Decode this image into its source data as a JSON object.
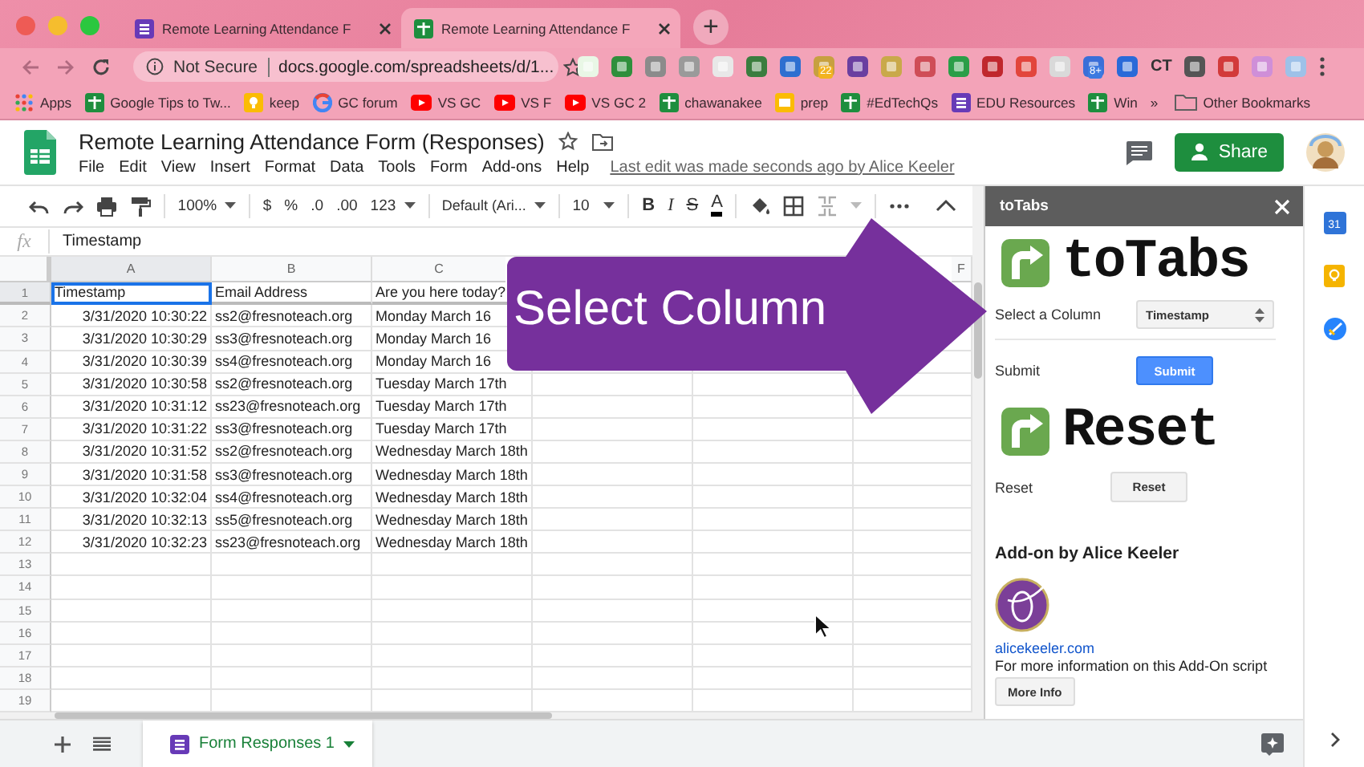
{
  "browser": {
    "tabs": [
      {
        "label": "Remote Learning Attendance F",
        "kind": "forms",
        "selected": false
      },
      {
        "label": "Remote Learning Attendance F",
        "kind": "sheets",
        "selected": true
      }
    ],
    "new_tab": "+",
    "address": {
      "security": "Not Secure",
      "url": "docs.google.com/spreadsheets/d/1..."
    },
    "extension_texts": [
      {
        "kind": "badge",
        "text": "22"
      },
      {
        "kind": "badge",
        "text": "8+"
      },
      {
        "kind": "label",
        "text": "CT"
      }
    ],
    "bookmarks": [
      {
        "label": "Apps",
        "kind": "apps"
      },
      {
        "label": "Google Tips to Tw...",
        "kind": "sheets"
      },
      {
        "label": "keep",
        "kind": "keep"
      },
      {
        "label": "GC forum",
        "kind": "google"
      },
      {
        "label": "VS GC",
        "kind": "youtube"
      },
      {
        "label": "VS F",
        "kind": "youtube"
      },
      {
        "label": "VS GC 2",
        "kind": "youtube"
      },
      {
        "label": "chawanakee",
        "kind": "sheets"
      },
      {
        "label": "prep",
        "kind": "slides"
      },
      {
        "label": "#EdTechQs",
        "kind": "sheets"
      },
      {
        "label": "EDU Resources",
        "kind": "forms"
      },
      {
        "label": "Win",
        "kind": "sheets"
      },
      {
        "label": "»",
        "kind": "more"
      },
      {
        "label": "Other Bookmarks",
        "kind": "folder"
      }
    ]
  },
  "document": {
    "title": "Remote Learning Attendance Form (Responses)",
    "menu": [
      "File",
      "Edit",
      "View",
      "Insert",
      "Format",
      "Data",
      "Tools",
      "Form",
      "Add-ons",
      "Help"
    ],
    "last_edit": "Last edit was made seconds ago by Alice Keeler",
    "share": "Share"
  },
  "toolbar": {
    "zoom": "100%",
    "currency": "$",
    "percent": "%",
    "decrease_decimals": ".0",
    "increase_decimals": ".00",
    "number_format": "123",
    "font": "Default (Ari...",
    "font_size": "10",
    "bold": "B",
    "italic": "I",
    "strikethrough": "S",
    "text_color": "A"
  },
  "formula_bar": {
    "label": "fx",
    "value": "Timestamp"
  },
  "sheet": {
    "columns": [
      {
        "label": "A",
        "selected": true
      },
      {
        "label": "B",
        "selected": false
      },
      {
        "label": "C",
        "selected": false
      },
      {},
      {},
      {
        "label": "F",
        "selected": false
      }
    ],
    "rows": [
      {
        "number": "1",
        "selected": true,
        "cells": [
          "Timestamp",
          "Email Address",
          "Are you here today?"
        ]
      },
      {
        "number": "2",
        "selected": false,
        "cells": [
          "3/31/2020 10:30:22",
          "ss2@fresnoteach.org",
          "Monday March 16"
        ]
      },
      {
        "number": "3",
        "selected": false,
        "cells": [
          "3/31/2020 10:30:29",
          "ss3@fresnoteach.org",
          "Monday March 16"
        ]
      },
      {
        "number": "4",
        "selected": false,
        "cells": [
          "3/31/2020 10:30:39",
          "ss4@fresnoteach.org",
          "Monday March 16"
        ]
      },
      {
        "number": "5",
        "selected": false,
        "cells": [
          "3/31/2020 10:30:58",
          "ss2@fresnoteach.org",
          "Tuesday March 17th"
        ]
      },
      {
        "number": "6",
        "selected": false,
        "cells": [
          "3/31/2020 10:31:12",
          "ss23@fresnoteach.org",
          "Tuesday March 17th"
        ]
      },
      {
        "number": "7",
        "selected": false,
        "cells": [
          "3/31/2020 10:31:22",
          "ss3@fresnoteach.org",
          "Tuesday March 17th"
        ]
      },
      {
        "number": "8",
        "selected": false,
        "cells": [
          "3/31/2020 10:31:52",
          "ss2@fresnoteach.org",
          "Wednesday March 18th"
        ]
      },
      {
        "number": "9",
        "selected": false,
        "cells": [
          "3/31/2020 10:31:58",
          "ss3@fresnoteach.org",
          "Wednesday March 18th"
        ]
      },
      {
        "number": "10",
        "selected": false,
        "cells": [
          "3/31/2020 10:32:04",
          "ss4@fresnoteach.org",
          "Wednesday March 18th"
        ]
      },
      {
        "number": "11",
        "selected": false,
        "cells": [
          "3/31/2020 10:32:13",
          "ss5@fresnoteach.org",
          "Wednesday March 18th"
        ]
      },
      {
        "number": "12",
        "selected": false,
        "cells": [
          "3/31/2020 10:32:23",
          "ss23@fresnoteach.org",
          "Wednesday March 18th"
        ]
      },
      {
        "number": "13",
        "selected": false,
        "cells": []
      },
      {
        "number": "14",
        "selected": false,
        "cells": []
      },
      {
        "number": "15",
        "selected": false,
        "cells": []
      },
      {
        "number": "16",
        "selected": false,
        "cells": []
      },
      {
        "number": "17",
        "selected": false,
        "cells": []
      },
      {
        "number": "18",
        "selected": false,
        "cells": []
      },
      {
        "number": "19",
        "selected": false,
        "cells": []
      }
    ],
    "sheet_tab": "Form Responses 1"
  },
  "callout": {
    "text": "Select Column"
  },
  "sidebar": {
    "title": "toTabs",
    "logo_text": "toTabs",
    "select_label": "Select a Column",
    "select_value": "Timestamp",
    "submit_label": "Submit",
    "submit_button": "Submit",
    "reset_logo_text": "Reset",
    "reset_label": "Reset",
    "reset_button": "Reset",
    "credit": "Add-on by Alice Keeler",
    "link": "alicekeeler.com",
    "info": "For more information on this Add-On script",
    "more_button": "More Info"
  },
  "side_panel": {
    "calendar_day": "31"
  }
}
